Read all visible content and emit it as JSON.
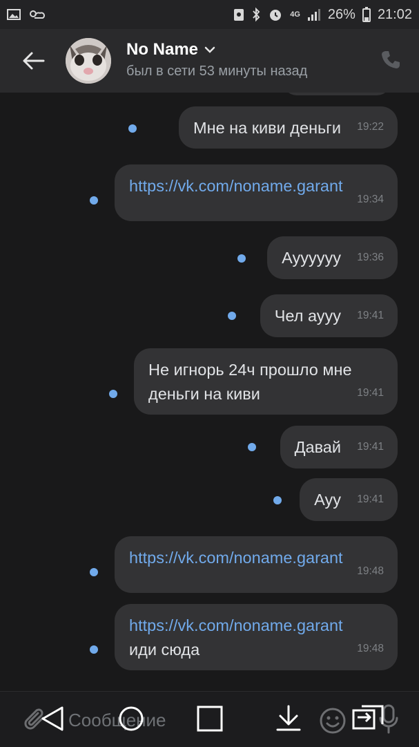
{
  "status_bar": {
    "battery": "26%",
    "time": "21:02",
    "network": "4G"
  },
  "header": {
    "name": "No Name",
    "last_seen": "был в сети 53 минуты назад"
  },
  "messages": [
    {
      "text": "Мне на киви деньги",
      "time": "19:22",
      "link": false
    },
    {
      "text": "https://vk.com/noname.garant",
      "time": "19:34",
      "link": true
    },
    {
      "text": "Ауууууу",
      "time": "19:36",
      "link": false
    },
    {
      "text": "Чел аууу",
      "time": "19:41",
      "link": false
    },
    {
      "text": "Не игнорь 24ч прошло мне\nденьги на киви",
      "time": "19:41",
      "link": false
    },
    {
      "text": "Давай",
      "time": "19:41",
      "link": false
    },
    {
      "text": "Ауу",
      "time": "19:41",
      "link": false
    },
    {
      "text": "https://vk.com/noname.garant",
      "time": "19:48",
      "link": true
    },
    {
      "link_text": "https://vk.com/noname.garant",
      "text": "иди сюда",
      "time": "19:48",
      "link": true
    }
  ],
  "composer": {
    "placeholder": "Сообщение"
  },
  "colors": {
    "background": "#19191a",
    "bubble": "#333335",
    "link": "#71aaeb",
    "unread_dot": "#71aaeb",
    "header": "#2a2a2c"
  },
  "icons": [
    "gallery-icon",
    "weather-icon",
    "saver-icon",
    "bluetooth-icon",
    "alarm-icon",
    "signal-icon",
    "battery-icon",
    "back-arrow-icon",
    "chevron-down-icon",
    "phone-icon",
    "paperclip-icon",
    "emoji-icon",
    "microphone-icon",
    "nav-back-icon",
    "nav-home-icon",
    "nav-recents-icon",
    "nav-down-icon",
    "nav-switch-icon"
  ]
}
